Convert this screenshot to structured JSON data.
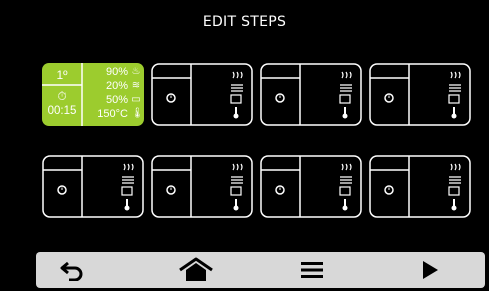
{
  "header": {
    "title": "EDIT STEPS"
  },
  "steps": [
    {
      "active": true,
      "step_number": "1º",
      "time": "00:15",
      "humidity_pct": "90%",
      "fan_pct": "20%",
      "power_pct": "50%",
      "temperature": "150°C"
    },
    {
      "active": false
    },
    {
      "active": false
    },
    {
      "active": false
    },
    {
      "active": false
    },
    {
      "active": false
    },
    {
      "active": false
    },
    {
      "active": false
    }
  ],
  "colors": {
    "active_fill": "#9ccc2e",
    "background": "#000000",
    "nav_bar": "#d8d8d8",
    "nav_icon": "#000000",
    "outline": "#ffffff"
  },
  "icons": {
    "step_clock": "clock-icon",
    "humidity": "steam-icon",
    "fan": "fan-icon",
    "power": "heating-element-icon",
    "temperature": "thermometer-icon",
    "back": "back-arrow-icon",
    "home": "home-icon",
    "menu": "menu-icon",
    "next": "play-icon"
  }
}
